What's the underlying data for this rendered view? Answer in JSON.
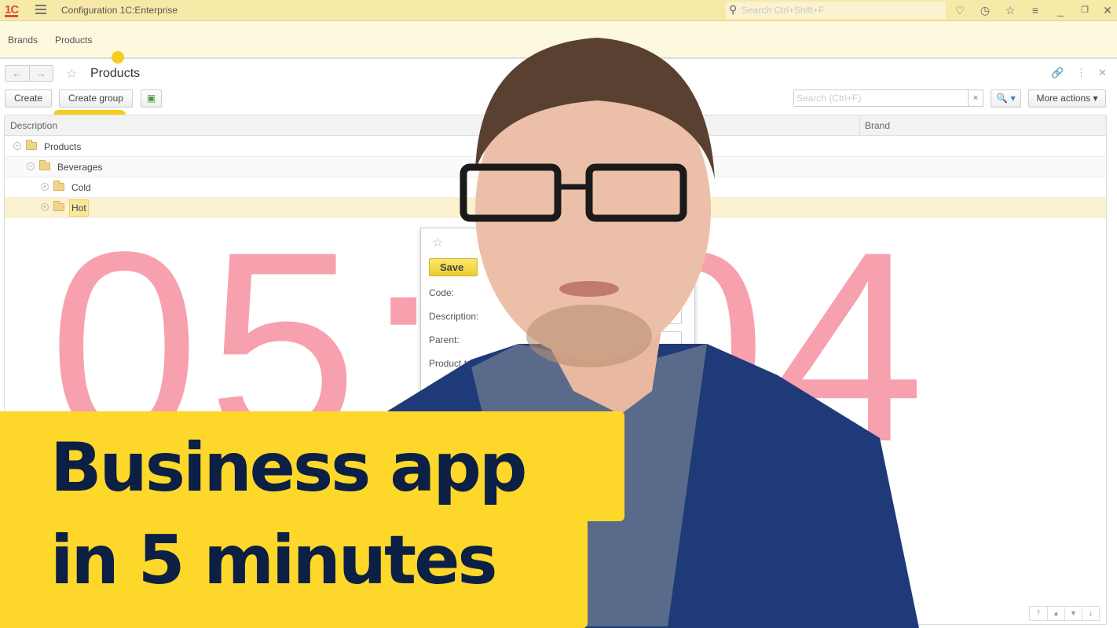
{
  "titlebar": {
    "logo": "1C",
    "app_title": "Configuration 1C:Enterprise",
    "search_placeholder": "Search Ctrl+Shift+F",
    "icons": [
      "bell-icon",
      "history-icon",
      "star-icon",
      "menu-filter-icon",
      "minimize-icon",
      "restore-icon",
      "close-icon"
    ]
  },
  "sections": {
    "items": [
      {
        "label": "Brands"
      },
      {
        "label": "Products"
      }
    ]
  },
  "form": {
    "title": "Products",
    "nav_back": "←",
    "nav_forward": "→",
    "commands": {
      "create": "Create",
      "create_group": "Create group",
      "search_placeholder": "Search (Ctrl+F)",
      "clear": "×",
      "search_button": "🔍 ▾",
      "more_actions": "More actions ▾"
    }
  },
  "table": {
    "columns": [
      "Description",
      "Brand"
    ],
    "rows": [
      {
        "level": 0,
        "label": "Products",
        "expanded": true,
        "brand": ""
      },
      {
        "level": 1,
        "label": "Beverages",
        "expanded": true,
        "brand": ""
      },
      {
        "level": 2,
        "label": "Cold",
        "expanded": false,
        "brand": ""
      },
      {
        "level": 2,
        "label": "Hot",
        "expanded": false,
        "brand": "",
        "selected": true
      }
    ]
  },
  "dialog": {
    "save_label": "Save",
    "fields": [
      {
        "label": "Code:"
      },
      {
        "label": "Description:"
      },
      {
        "label": "Parent:"
      },
      {
        "label": "Product ty..."
      }
    ]
  },
  "timer": {
    "text": "05:  :04",
    "minutes_visible": "05",
    "seconds_visible": "04",
    "color": "#f7a1ae"
  },
  "banner": {
    "line1": "Business app",
    "line2": "in 5 minutes",
    "bg_color": "#fdd82a",
    "text_color": "#0c1f45"
  }
}
